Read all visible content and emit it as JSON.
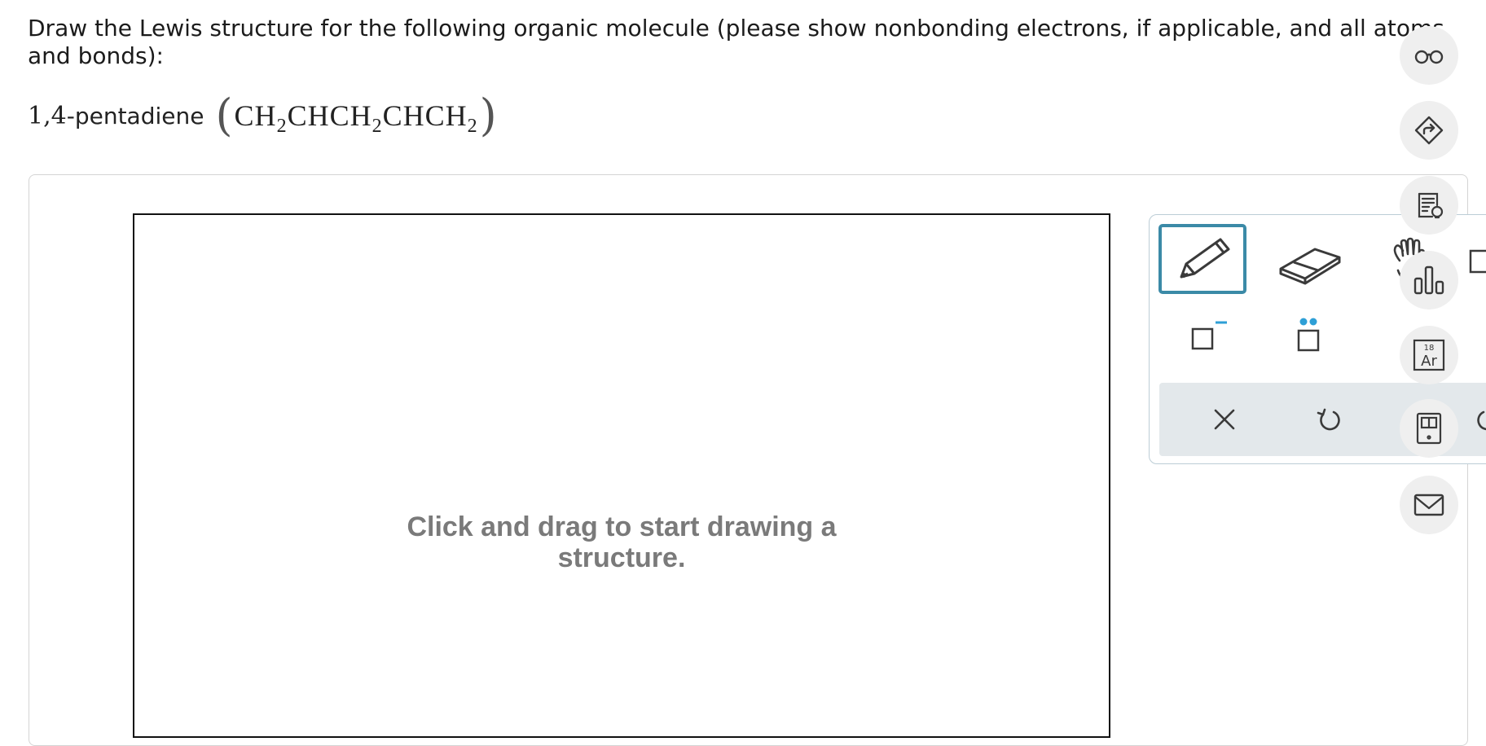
{
  "question": {
    "prompt": "Draw the Lewis structure for the following organic molecule (please show nonbonding electrons, if applicable, and all atoms and bonds):",
    "compound_locant": "1,4",
    "compound_suffix": "-pentadiene",
    "formula_parts": [
      "CH",
      "2",
      "CHCH",
      "2",
      "CHCH",
      "2"
    ],
    "paren_open": "(",
    "paren_close": ")"
  },
  "canvas": {
    "hint": "Click and drag to start drawing a structure."
  },
  "toolbox": {
    "tools": [
      "pencil-icon",
      "eraser-icon",
      "hand-icon",
      "box-icon",
      "charge-box-icon",
      "lone-pair-box-icon",
      "clear-icon",
      "undo-icon",
      "redo-icon"
    ],
    "selected_tool": "pencil",
    "accent_color": "#3b8aa7",
    "lone_pair_color": "#2e9fd6"
  },
  "sidebar": {
    "buttons": [
      "reading-glasses-icon",
      "share-arrow-icon",
      "checklist-bulb-icon",
      "bar-chart-icon",
      "periodic-table-icon",
      "calculator-icon",
      "mail-icon"
    ],
    "periodic_number": "18",
    "periodic_symbol": "Ar"
  }
}
